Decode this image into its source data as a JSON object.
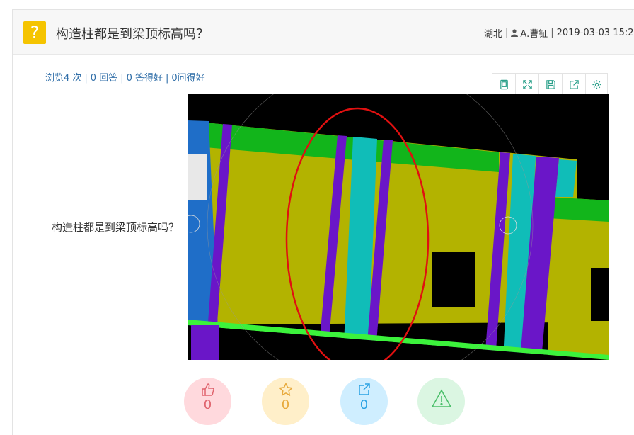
{
  "question": {
    "badge": "?",
    "title": "构造柱都是到梁顶标高吗？",
    "region": "湖北",
    "author": "A.曹钲",
    "datetime": "2019-03-03 15:2",
    "body_text": "构造柱都是到梁顶标高吗？"
  },
  "stats": {
    "views": "浏览4 次",
    "answers": "0 回答",
    "good_answers": "0 答得好",
    "asked_good": "0问得好"
  },
  "toolbar": {
    "icons": [
      "tablet-icon",
      "expand-icon",
      "save-icon",
      "share-icon",
      "settings-icon"
    ]
  },
  "actions": {
    "like_count": "0",
    "favorite_count": "0",
    "share_count": "0"
  },
  "colors": {
    "badge": "#f5c400",
    "link": "#2f6ea8",
    "like": "#e0646e",
    "favorite": "#e7a93b",
    "share": "#2aa2e3",
    "report": "#4cbf6b"
  }
}
